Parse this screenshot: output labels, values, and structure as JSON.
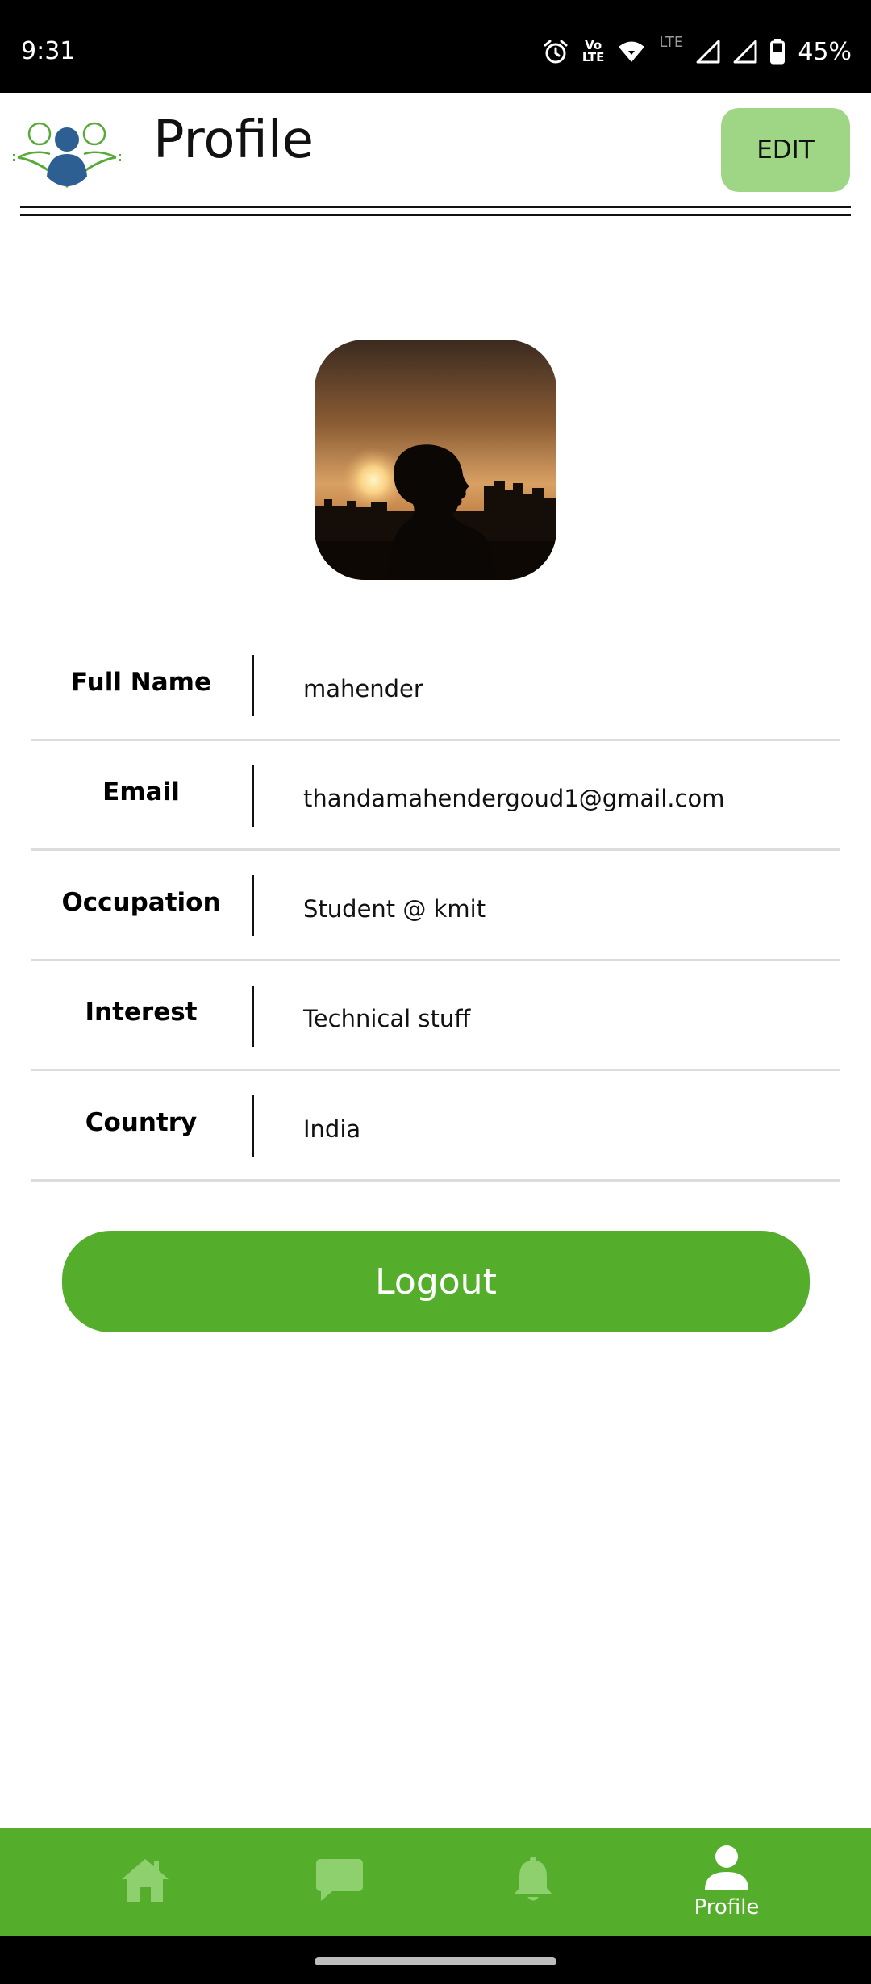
{
  "status_bar": {
    "time": "9:31",
    "volte_top": "Vo",
    "volte_bottom": "LTE",
    "network": "LTE",
    "battery": "45%",
    "icons": [
      "alarm-icon",
      "volte-icon",
      "wifi-icon",
      "signal-icon",
      "signal-icon",
      "battery-icon"
    ]
  },
  "header": {
    "title": "Profile",
    "edit_label": "EDIT",
    "logo_icon": "people-logo-icon"
  },
  "profile": {
    "avatar_icon": "profile-photo",
    "fields": [
      {
        "label": "Full Name",
        "value": "mahender"
      },
      {
        "label": "Email",
        "value": "thandamahendergoud1@gmail.com"
      },
      {
        "label": "Occupation",
        "value": "Student @ kmit"
      },
      {
        "label": "Interest",
        "value": "Technical stuff"
      },
      {
        "label": "Country",
        "value": "India"
      }
    ]
  },
  "logout_label": "Logout",
  "bottom_nav": {
    "items": [
      {
        "icon": "home-icon",
        "label": ""
      },
      {
        "icon": "chat-icon",
        "label": ""
      },
      {
        "icon": "bell-icon",
        "label": ""
      },
      {
        "icon": "person-icon",
        "label": "Profile",
        "active": true
      }
    ]
  },
  "colors": {
    "accent_green": "#54ae2b",
    "edit_button": "#9ed686",
    "nav_inactive_icon": "#8fd06e",
    "logo_blue": "#2e5f93"
  }
}
